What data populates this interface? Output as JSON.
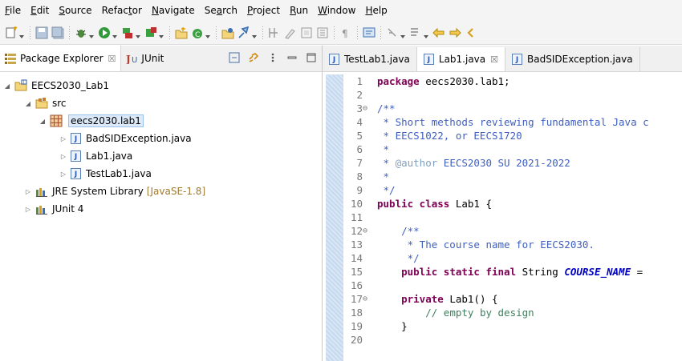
{
  "menu": [
    {
      "name": "file",
      "pre": "",
      "u": "F",
      "post": "ile"
    },
    {
      "name": "edit",
      "pre": "",
      "u": "E",
      "post": "dit"
    },
    {
      "name": "source",
      "pre": "",
      "u": "S",
      "post": "ource"
    },
    {
      "name": "refactor",
      "pre": "Refac",
      "u": "t",
      "post": "or"
    },
    {
      "name": "navigate",
      "pre": "",
      "u": "N",
      "post": "avigate"
    },
    {
      "name": "search",
      "pre": "Se",
      "u": "a",
      "post": "rch"
    },
    {
      "name": "project",
      "pre": "",
      "u": "P",
      "post": "roject"
    },
    {
      "name": "run",
      "pre": "",
      "u": "R",
      "post": "un"
    },
    {
      "name": "window",
      "pre": "",
      "u": "W",
      "post": "indow"
    },
    {
      "name": "help",
      "pre": "",
      "u": "H",
      "post": "elp"
    }
  ],
  "toolbar_icons": [
    "new-wizard-icon",
    "dropdown-arrow",
    "sep",
    "save-icon",
    "save-all-icon",
    "sep",
    "debug-icon",
    "dropdown-arrow",
    "run-icon",
    "dropdown-arrow",
    "coverage-icon",
    "dropdown-arrow",
    "external-tools-icon",
    "dropdown-arrow",
    "sep",
    "new-java-project-icon",
    "new-class-icon",
    "dropdown-arrow",
    "sep",
    "open-type-icon",
    "search-icon",
    "dropdown-arrow",
    "sep",
    "toggle-breadcrumb-icon",
    "mark-occurrences-icon",
    "block-selection-icon",
    "show-whitespace-icon",
    "sep",
    "word-wrap-icon",
    "sep",
    "next-annotation-icon",
    "sep",
    "prev-annotation-icon",
    "dropdown-arrow",
    "last-edit-icon",
    "dropdown-arrow",
    "back-icon",
    "forward-icon",
    "more-icon"
  ],
  "colors": {
    "keyword": "#7f0055",
    "comment": "#3f7f5f",
    "javadoc": "#3f5fbf",
    "field": "#0000c0",
    "selection": "#dbe9f9"
  },
  "left_tabs": {
    "package_explorer": "Package Explorer",
    "package_explorer_close": "☒",
    "junit": "JUnit"
  },
  "tree": {
    "project": "EECS2030_Lab1",
    "src": "src",
    "package": "eecs2030.lab1",
    "files": [
      "BadSIDException.java",
      "Lab1.java",
      "TestLab1.java"
    ],
    "jre": "JRE System Library",
    "jre_decor": "[JavaSE-1.8]",
    "junit": "JUnit 4"
  },
  "editor_tabs": [
    {
      "label": "TestLab1.java",
      "active": false,
      "close": ""
    },
    {
      "label": "Lab1.java",
      "active": true,
      "close": "☒"
    },
    {
      "label": "BadSIDException.java",
      "active": false,
      "close": ""
    }
  ],
  "code_lines": [
    {
      "n": "1",
      "fold": "",
      "html": "<span class=\"kw\">package</span> eecs2030.lab1;"
    },
    {
      "n": "2",
      "fold": "",
      "html": ""
    },
    {
      "n": "3",
      "fold": "⊖",
      "html": "<span class=\"jd\">/**</span>"
    },
    {
      "n": "4",
      "fold": "",
      "html": "<span class=\"jd\"> * Short methods reviewing fundamental Java c</span>"
    },
    {
      "n": "5",
      "fold": "",
      "html": "<span class=\"jd\"> * EECS1022, or EECS1720</span>"
    },
    {
      "n": "6",
      "fold": "",
      "html": "<span class=\"jd\"> *</span>"
    },
    {
      "n": "7",
      "fold": "",
      "html": "<span class=\"jd\"> * <span class=\"ann\">@author</span> EECS2030 SU 2021-2022</span>"
    },
    {
      "n": "8",
      "fold": "",
      "html": "<span class=\"jd\"> *</span>"
    },
    {
      "n": "9",
      "fold": "",
      "html": "<span class=\"jd\"> */</span>"
    },
    {
      "n": "10",
      "fold": "",
      "html": "<span class=\"kw\">public class</span> Lab1 {"
    },
    {
      "n": "11",
      "fold": "",
      "html": ""
    },
    {
      "n": "12",
      "fold": "⊖",
      "html": "    <span class=\"jd\">/**</span>"
    },
    {
      "n": "13",
      "fold": "",
      "html": "<span class=\"jd\">     * The course name for EECS2030.</span>"
    },
    {
      "n": "14",
      "fold": "",
      "html": "<span class=\"jd\">     */</span>"
    },
    {
      "n": "15",
      "fold": "",
      "html": "    <span class=\"kw\">public static final</span> String <span class=\"field\">COURSE_NAME</span> ="
    },
    {
      "n": "16",
      "fold": "",
      "html": ""
    },
    {
      "n": "17",
      "fold": "⊖",
      "html": "    <span class=\"kw\">private</span> Lab1() {"
    },
    {
      "n": "18",
      "fold": "",
      "html": "        <span class=\"cm\">// empty by design</span>"
    },
    {
      "n": "19",
      "fold": "",
      "html": "    }"
    },
    {
      "n": "20",
      "fold": "",
      "html": ""
    }
  ]
}
